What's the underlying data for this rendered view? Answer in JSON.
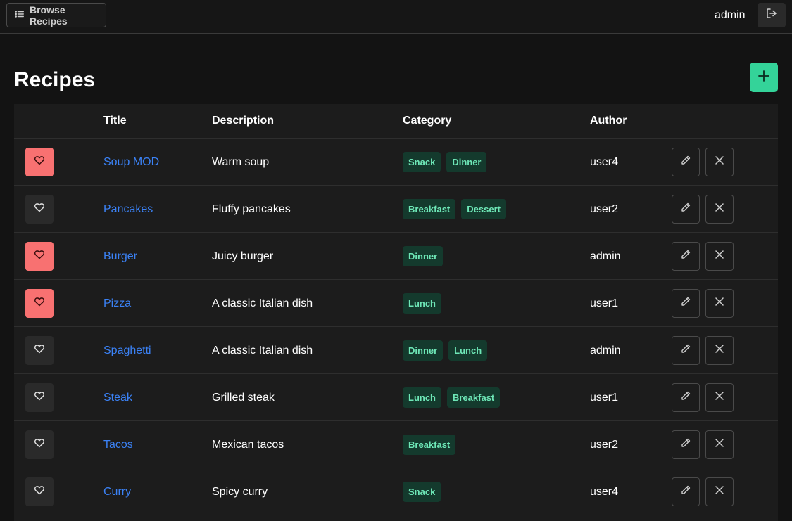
{
  "header": {
    "browse_label": "Browse Recipes",
    "username": "admin",
    "browse_icon": "list-icon",
    "logout_icon": "logout-icon"
  },
  "page": {
    "title": "Recipes",
    "add_icon": "plus-icon"
  },
  "table": {
    "columns": [
      "",
      "Title",
      "Description",
      "Category",
      "Author"
    ],
    "rows": [
      {
        "favorite": true,
        "title": "Soup MOD",
        "description": "Warm soup",
        "categories": [
          "Snack",
          "Dinner"
        ],
        "author": "user4"
      },
      {
        "favorite": false,
        "title": "Pancakes",
        "description": "Fluffy pancakes",
        "categories": [
          "Breakfast",
          "Dessert"
        ],
        "author": "user2"
      },
      {
        "favorite": true,
        "title": "Burger",
        "description": "Juicy burger",
        "categories": [
          "Dinner"
        ],
        "author": "admin"
      },
      {
        "favorite": true,
        "title": "Pizza",
        "description": "A classic Italian dish",
        "categories": [
          "Lunch"
        ],
        "author": "user1"
      },
      {
        "favorite": false,
        "title": "Spaghetti",
        "description": "A classic Italian dish",
        "categories": [
          "Dinner",
          "Lunch"
        ],
        "author": "admin"
      },
      {
        "favorite": false,
        "title": "Steak",
        "description": "Grilled steak",
        "categories": [
          "Lunch",
          "Breakfast"
        ],
        "author": "user1"
      },
      {
        "favorite": false,
        "title": "Tacos",
        "description": "Mexican tacos",
        "categories": [
          "Breakfast"
        ],
        "author": "user2"
      },
      {
        "favorite": false,
        "title": "Curry",
        "description": "Spicy curry",
        "categories": [
          "Snack"
        ],
        "author": "user4"
      }
    ]
  },
  "colors": {
    "background": "#131313",
    "accent": "#34d399",
    "link": "#3b82f6",
    "favorite_active": "#f87171",
    "badge_bg": "#143a2d",
    "badge_text": "#6ee7b7"
  }
}
